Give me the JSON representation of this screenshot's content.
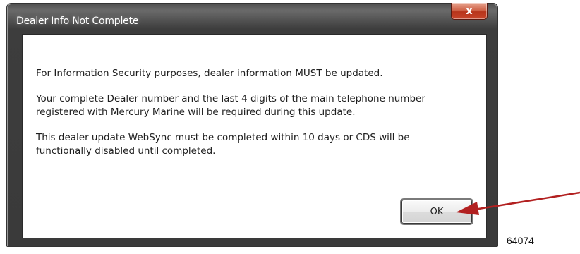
{
  "window": {
    "title": "Dealer Info Not Complete",
    "close_icon_glyph": "x"
  },
  "message": {
    "line1": "For Information Security purposes, dealer information MUST be updated.",
    "line2": "Your complete Dealer number and the last 4 digits of the main telephone number registered with Mercury Marine will be required during this update.",
    "line3": "This dealer update WebSync must be completed within 10 days or CDS will be functionally disabled until completed."
  },
  "buttons": {
    "ok_label": "OK"
  },
  "figure": {
    "number": "64074",
    "arrow_color": "#b22020"
  }
}
